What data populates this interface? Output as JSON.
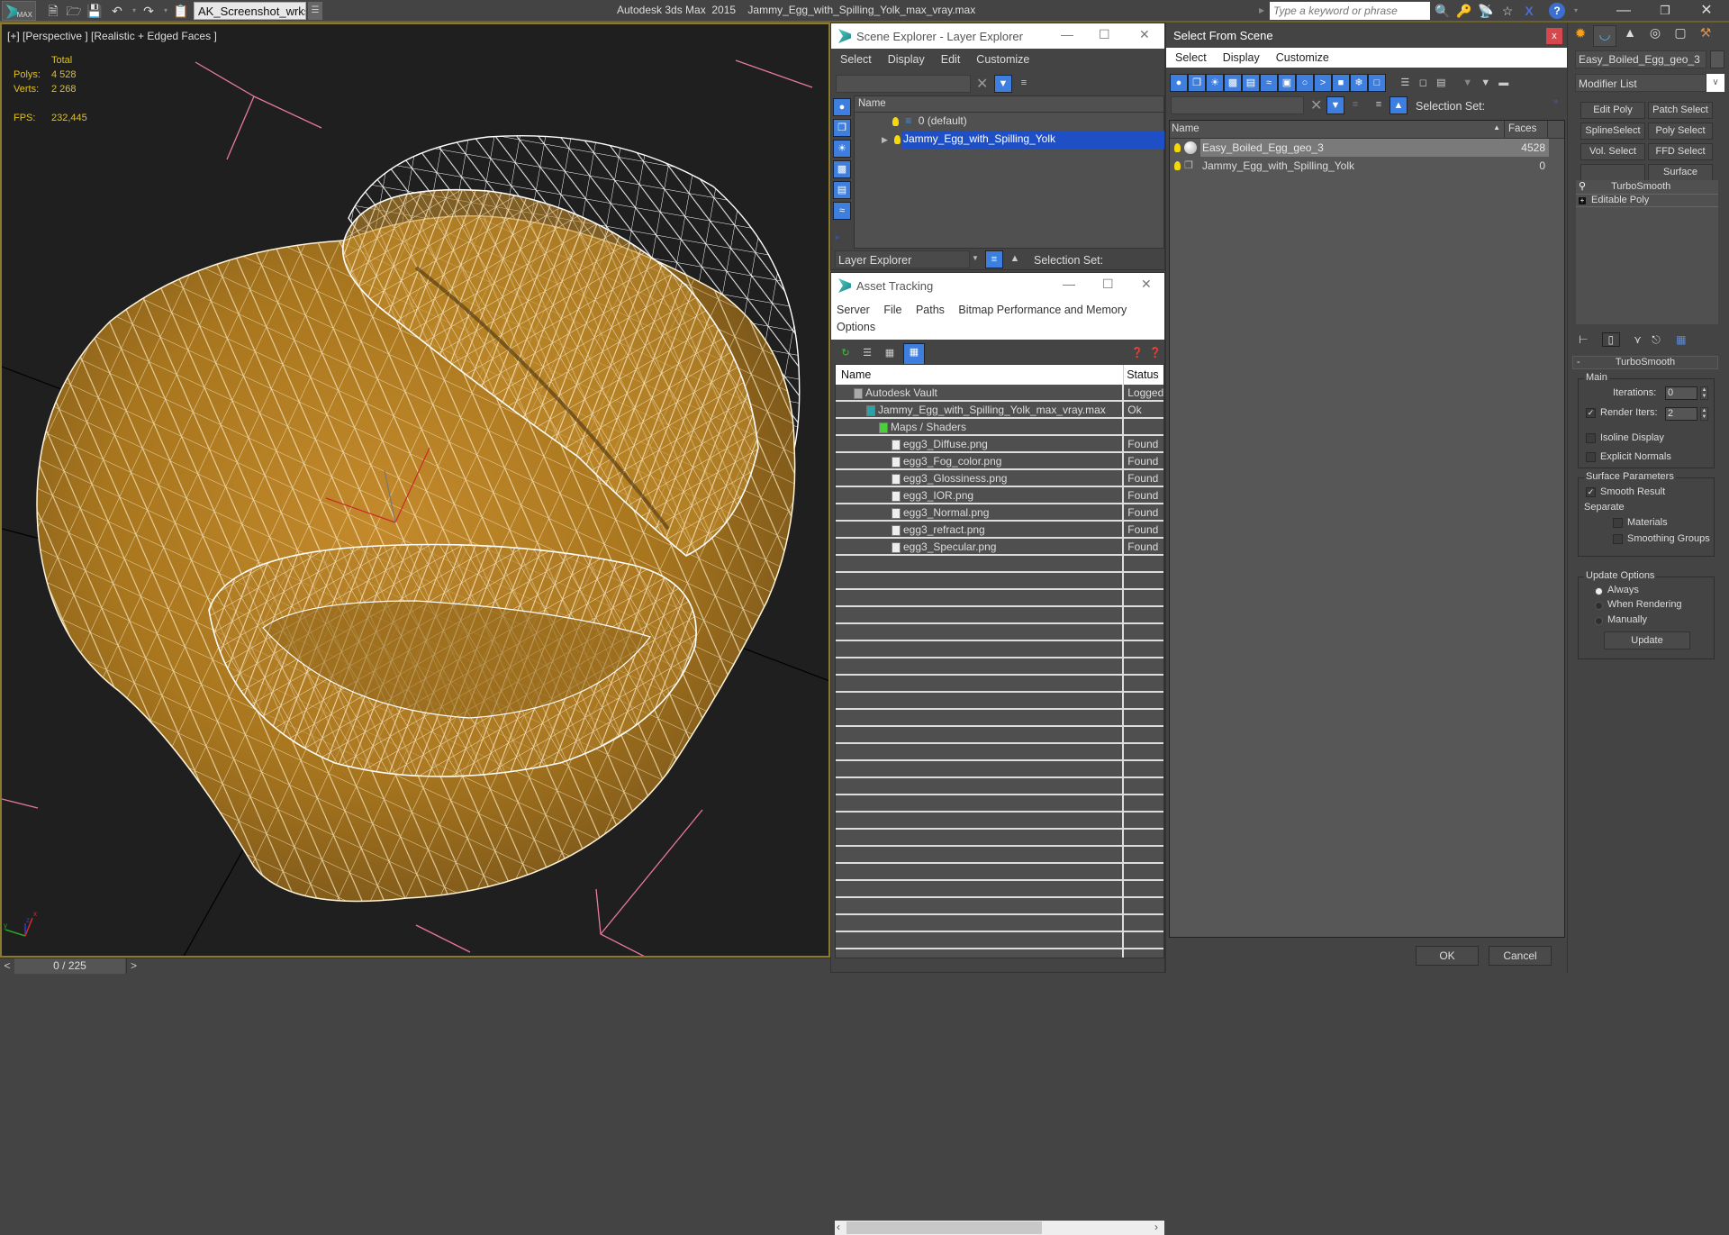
{
  "titlebar": {
    "app_title": "Autodesk 3ds Max  2015    Jammy_Egg_with_Spilling_Yolk_max_vray.max",
    "workspace": "AK_Screenshot_wrksp",
    "search_placeholder": "Type a keyword or phrase",
    "logo_text": "MAX"
  },
  "viewport": {
    "label": "[+] [Perspective ] [Realistic + Edged Faces ]",
    "stats": {
      "header": "Total",
      "polys_label": "Polys:",
      "polys_value": "4 528",
      "verts_label": "Verts:",
      "verts_value": "2 268",
      "fps_label": "FPS:",
      "fps_value": "232,445"
    },
    "axis": {
      "x": "x",
      "y": "y",
      "z": "z"
    }
  },
  "timeline": {
    "prev": "<",
    "frame": "0 / 225",
    "next": ">"
  },
  "scene_explorer": {
    "title": "Scene Explorer - Layer Explorer",
    "menu": [
      "Select",
      "Display",
      "Edit",
      "Customize"
    ],
    "column_name": "Name",
    "layers": [
      {
        "name": "0 (default)",
        "selected": false
      },
      {
        "name": "Jammy_Egg_with_Spilling_Yolk",
        "selected": true
      }
    ],
    "footer_mode": "Layer Explorer",
    "selection_set_label": "Selection Set:"
  },
  "asset_tracking": {
    "title": "Asset Tracking",
    "menu": [
      "Server",
      "File",
      "Paths",
      "Bitmap Performance and Memory",
      "Options"
    ],
    "columns": [
      "Name",
      "Status"
    ],
    "rows": [
      {
        "name": "Autodesk Vault",
        "status": "Logged",
        "indent": 0,
        "icon": "vault-icon"
      },
      {
        "name": "Jammy_Egg_with_Spilling_Yolk_max_vray.max",
        "status": "Ok",
        "indent": 1,
        "icon": "max-file-icon"
      },
      {
        "name": "Maps / Shaders",
        "status": "",
        "indent": 2,
        "icon": "maps-icon"
      },
      {
        "name": "egg3_Diffuse.png",
        "status": "Found",
        "indent": 3,
        "icon": "bitmap-icon"
      },
      {
        "name": "egg3_Fog_color.png",
        "status": "Found",
        "indent": 3,
        "icon": "bitmap-icon"
      },
      {
        "name": "egg3_Glossiness.png",
        "status": "Found",
        "indent": 3,
        "icon": "bitmap-icon"
      },
      {
        "name": "egg3_IOR.png",
        "status": "Found",
        "indent": 3,
        "icon": "bitmap-icon"
      },
      {
        "name": "egg3_Normal.png",
        "status": "Found",
        "indent": 3,
        "icon": "bitmap-icon"
      },
      {
        "name": "egg3_refract.png",
        "status": "Found",
        "indent": 3,
        "icon": "bitmap-icon"
      },
      {
        "name": "egg3_Specular.png",
        "status": "Found",
        "indent": 3,
        "icon": "bitmap-icon"
      }
    ]
  },
  "select_from_scene": {
    "title": "Select From Scene",
    "close": "x",
    "menu": [
      "Select",
      "Display",
      "Customize"
    ],
    "selection_set_label": "Selection Set:",
    "columns": [
      "Name",
      "Faces"
    ],
    "objects": [
      {
        "name": "Easy_Boiled_Egg_geo_3",
        "faces": "4528",
        "selected": true
      },
      {
        "name": "Jammy_Egg_with_Spilling_Yolk",
        "faces": "0",
        "selected": false
      }
    ],
    "ok": "OK",
    "cancel": "Cancel"
  },
  "command_panel": {
    "object_name": "Easy_Boiled_Egg_geo_3",
    "modifier_list": "Modifier List",
    "modifier_buttons": [
      "Edit Poly",
      "Patch Select",
      "SplineSelect",
      "Poly Select",
      "Vol. Select",
      "FFD Select",
      "",
      "Surface Select"
    ],
    "stack": [
      "TurboSmooth",
      "Editable Poly"
    ],
    "rollout": {
      "title": "TurboSmooth",
      "collapse": "-",
      "main_label": "Main",
      "iterations_label": "Iterations:",
      "iterations_value": "0",
      "render_iters_label": "Render Iters:",
      "render_iters_value": "2",
      "render_iters_checked": true,
      "isoline_label": "Isoline Display",
      "isoline_checked": false,
      "explicit_normals_label": "Explicit Normals",
      "explicit_normals_checked": false,
      "surface_label": "Surface Parameters",
      "smooth_result_label": "Smooth Result",
      "smooth_result_checked": true,
      "separate_label": "Separate",
      "materials_label": "Materials",
      "smoothing_groups_label": "Smoothing Groups",
      "update_options_label": "Update Options",
      "always_label": "Always",
      "when_rendering_label": "When Rendering",
      "manually_label": "Manually",
      "update_mode": "Always",
      "update_button": "Update"
    }
  }
}
